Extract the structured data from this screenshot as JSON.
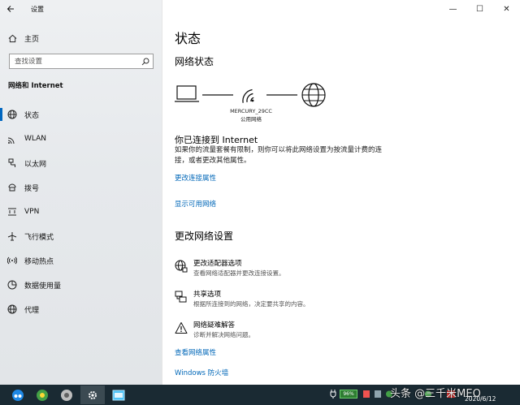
{
  "window": {
    "app_title": "设置",
    "back_icon": "back-arrow-icon",
    "caption": {
      "minimize": "—",
      "maximize": "☐",
      "close": "✕"
    }
  },
  "sidebar": {
    "home_label": "主页",
    "search_placeholder": "查找设置",
    "section_title": "网络和 Internet",
    "items": [
      {
        "label": "状态",
        "icon": "globe-status-icon",
        "selected": true
      },
      {
        "label": "WLAN",
        "icon": "wifi-icon",
        "selected": false
      },
      {
        "label": "以太网",
        "icon": "ethernet-icon",
        "selected": false
      },
      {
        "label": "拨号",
        "icon": "dialup-icon",
        "selected": false
      },
      {
        "label": "VPN",
        "icon": "vpn-icon",
        "selected": false
      },
      {
        "label": "飞行模式",
        "icon": "airplane-icon",
        "selected": false
      },
      {
        "label": "移动热点",
        "icon": "hotspot-icon",
        "selected": false
      },
      {
        "label": "数据使用量",
        "icon": "data-usage-icon",
        "selected": false
      },
      {
        "label": "代理",
        "icon": "proxy-globe-icon",
        "selected": false
      }
    ]
  },
  "main": {
    "title": "状态",
    "network_status_heading": "网络状态",
    "network_name": "MERCURY_29CC",
    "network_type": "公用网络",
    "connected_title": "你已连接到 Internet",
    "connected_desc": "如果你的流量套餐有限制，则你可以将此网络设置为按流量计费的连接，或者更改其他属性。",
    "link_change_props": "更改连接属性",
    "link_show_networks": "显示可用网络",
    "change_heading": "更改网络设置",
    "options": [
      {
        "title": "更改适配器选项",
        "desc": "查看网络适配器并更改连接设置。",
        "icon": "adapter-globe-icon"
      },
      {
        "title": "共享选项",
        "desc": "根据所连接到的网络，决定要共享的内容。",
        "icon": "sharing-icon"
      },
      {
        "title": "网络疑难解答",
        "desc": "诊断并解决网络问题。",
        "icon": "warning-icon"
      }
    ],
    "link_view_props": "查看网络属性",
    "link_firewall": "Windows 防火墙"
  },
  "taskbar": {
    "battery": "96%",
    "date": "2020/6/12",
    "watermark": "头条 @三千米MEO",
    "colors": {
      "bar": "#1a2a33",
      "accent": "#0067c0",
      "link": "#0067b8"
    }
  }
}
